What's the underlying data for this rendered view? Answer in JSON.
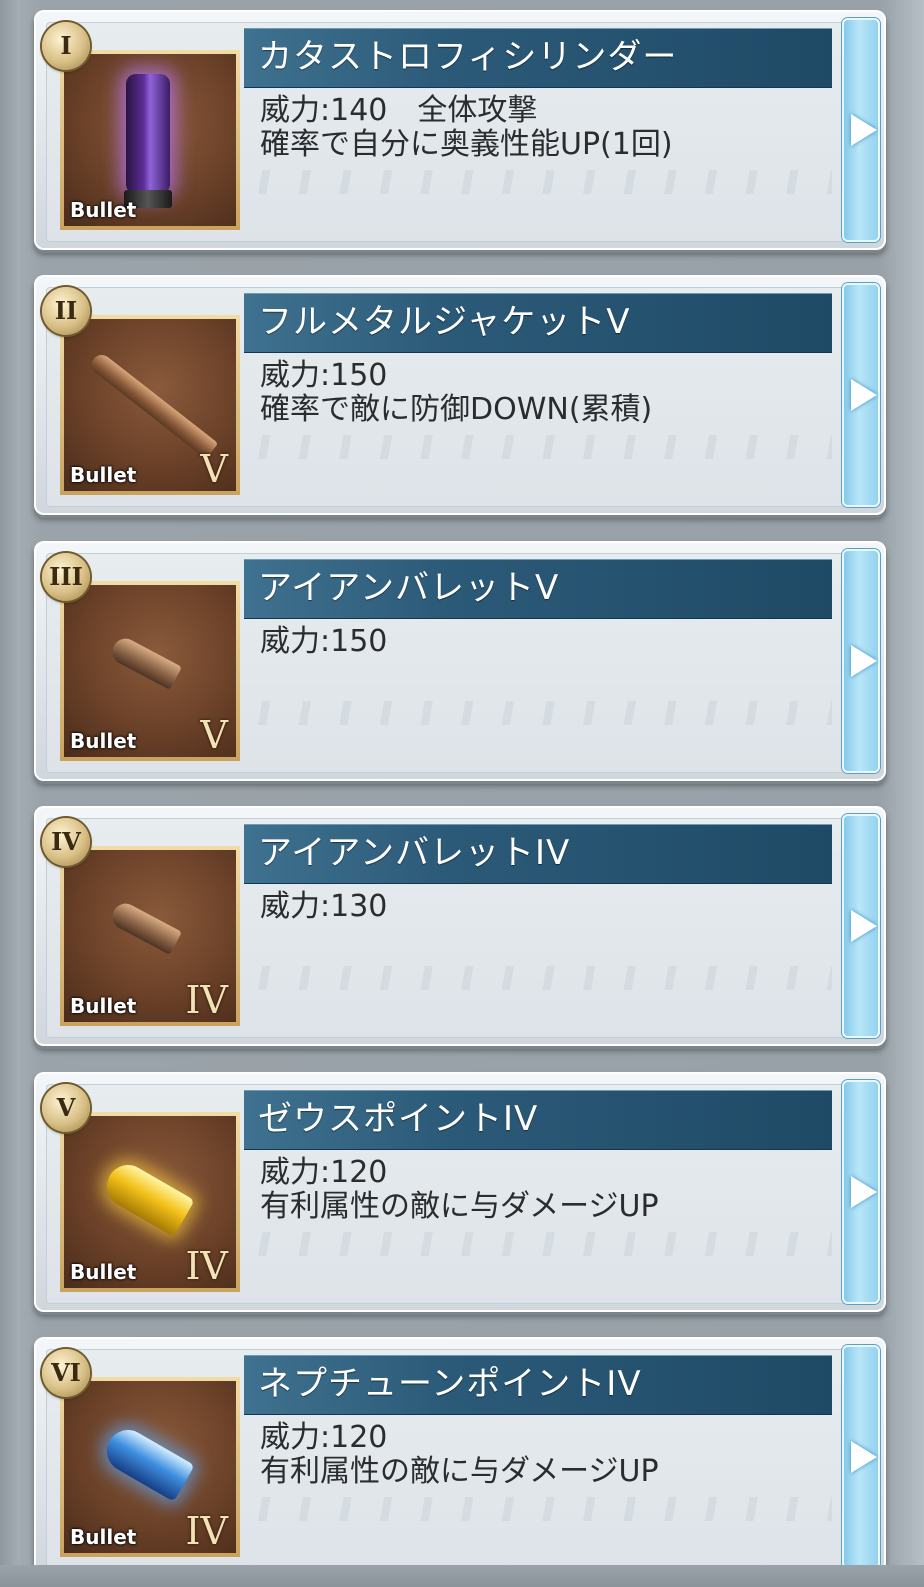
{
  "items": [
    {
      "number": "I",
      "name": "カタストロフィシリンダー",
      "lines": [
        "威力:140　全体攻撃",
        "確率で自分に奥義性能UP(1回)"
      ],
      "icon": {
        "name": "cylinder-bullet-icon",
        "label": "Bullet",
        "rank": ""
      }
    },
    {
      "number": "II",
      "name": "フルメタルジャケットV",
      "lines": [
        "威力:150",
        "確率で敵に防御DOWN(累積)"
      ],
      "icon": {
        "name": "full-metal-jacket-icon",
        "label": "Bullet",
        "rank": "V"
      }
    },
    {
      "number": "III",
      "name": "アイアンバレットV",
      "lines": [
        "威力:150"
      ],
      "icon": {
        "name": "iron-bullet-icon",
        "label": "Bullet",
        "rank": "V"
      }
    },
    {
      "number": "IV",
      "name": "アイアンバレットIV",
      "lines": [
        "威力:130"
      ],
      "icon": {
        "name": "iron-bullet-icon",
        "label": "Bullet",
        "rank": "IV"
      }
    },
    {
      "number": "V",
      "name": "ゼウスポイントIV",
      "lines": [
        "威力:120",
        "有利属性の敵に与ダメージUP"
      ],
      "icon": {
        "name": "zeus-point-icon",
        "label": "Bullet",
        "rank": "IV"
      }
    },
    {
      "number": "VI",
      "name": "ネプチューンポイントIV",
      "lines": [
        "威力:120",
        "有利属性の敵に与ダメージUP"
      ],
      "icon": {
        "name": "neptune-point-icon",
        "label": "Bullet",
        "rank": "IV"
      }
    }
  ],
  "colors": {
    "title_bar": "#2b5a78",
    "side_button": "#8fd0ee",
    "badge": "#d8bf86"
  }
}
